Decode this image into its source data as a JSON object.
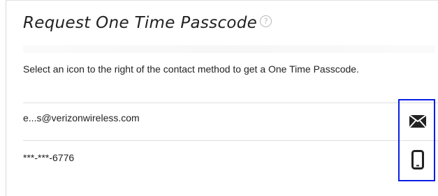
{
  "header": {
    "title": "Request One Time Passcode",
    "help_icon": "help-circle-icon"
  },
  "instructions": "Select an icon to the right of the contact method to get a One Time Passcode.",
  "contacts": [
    {
      "label": "e...s@verizonwireless.com",
      "icon": "envelope-icon"
    },
    {
      "label": "***-***-6776",
      "icon": "mobile-phone-icon"
    }
  ],
  "colors": {
    "highlight_border": "#0a1ee6",
    "icon": "#222222",
    "divider": "#dddddd"
  }
}
